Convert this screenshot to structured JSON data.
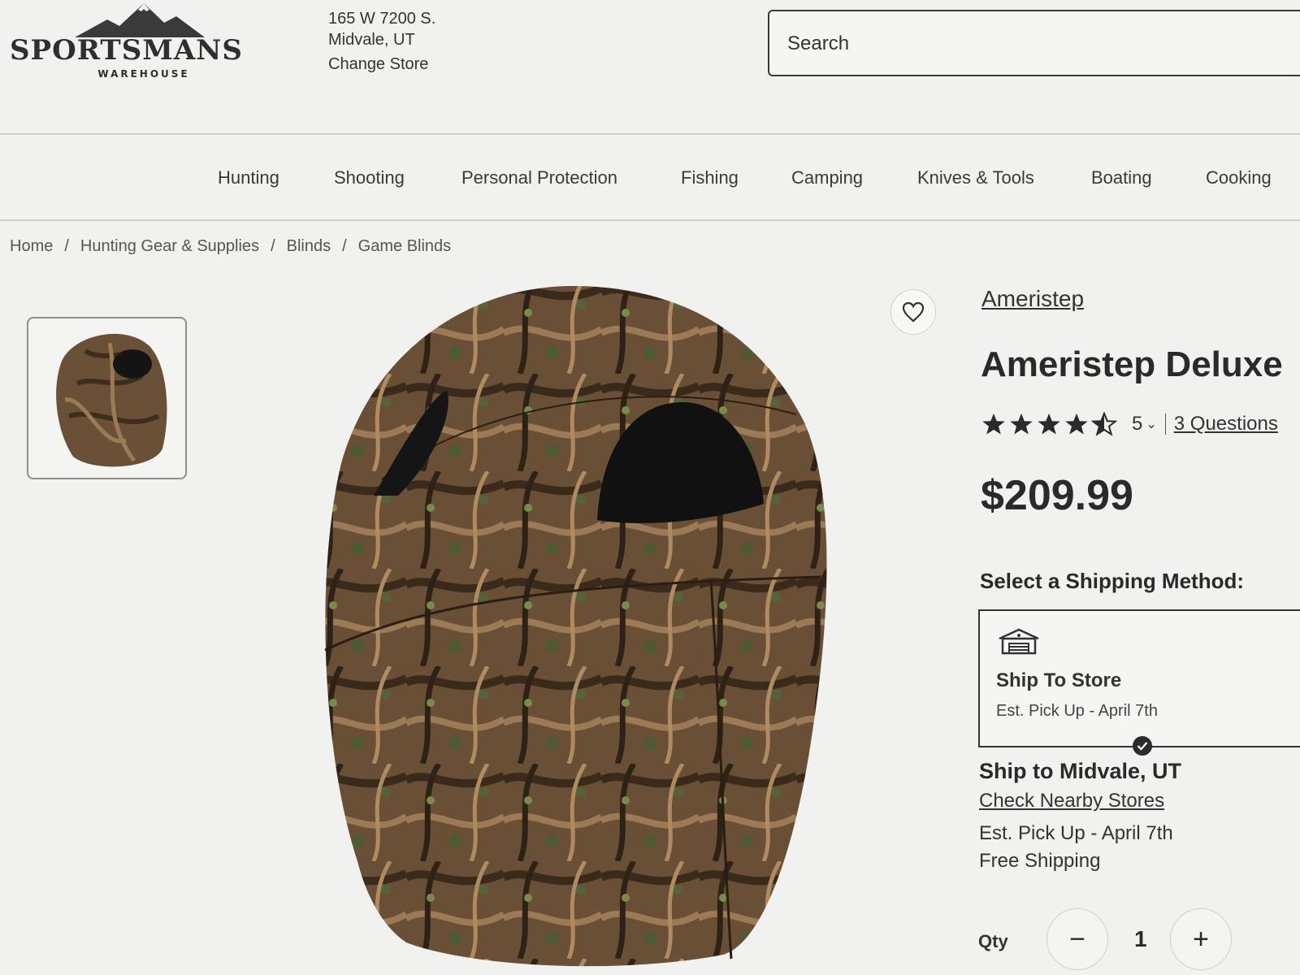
{
  "brand_logo": {
    "wordmark": "SPORTSMANS",
    "subtitle": "WAREHOUSE"
  },
  "store": {
    "address_line1": "165 W 7200 S.",
    "address_line2": "Midvale, UT",
    "change_label": "Change Store"
  },
  "search": {
    "placeholder": "Search"
  },
  "nav": {
    "items": [
      "Hunting",
      "Shooting",
      "Personal Protection",
      "Fishing",
      "Camping",
      "Knives & Tools",
      "Boating",
      "Cooking"
    ]
  },
  "breadcrumb": {
    "items": [
      "Home",
      "Hunting Gear & Supplies",
      "Blinds",
      "Game Blinds"
    ],
    "separator": "/"
  },
  "product": {
    "brand": "Ameristep",
    "title": "Ameristep Deluxe",
    "rating": 4.5,
    "review_count": "5",
    "questions": "3 Questions",
    "price": "$209.99"
  },
  "shipping": {
    "heading": "Select a Shipping Method:",
    "option_title": "Ship To Store",
    "option_subtitle": "Est. Pick Up - April 7th",
    "option_selected": true,
    "ship_to": "Ship to Midvale, UT",
    "nearby_link": "Check Nearby Stores",
    "est_pickup": "Est. Pick Up - April 7th",
    "free_shipping": "Free Shipping"
  },
  "quantity": {
    "label": "Qty",
    "value": "1",
    "minus": "−",
    "plus": "+"
  },
  "colors": {
    "text": "#2b2b2b",
    "background": "#f1f1ef",
    "camo_brown": "#6b5038"
  }
}
